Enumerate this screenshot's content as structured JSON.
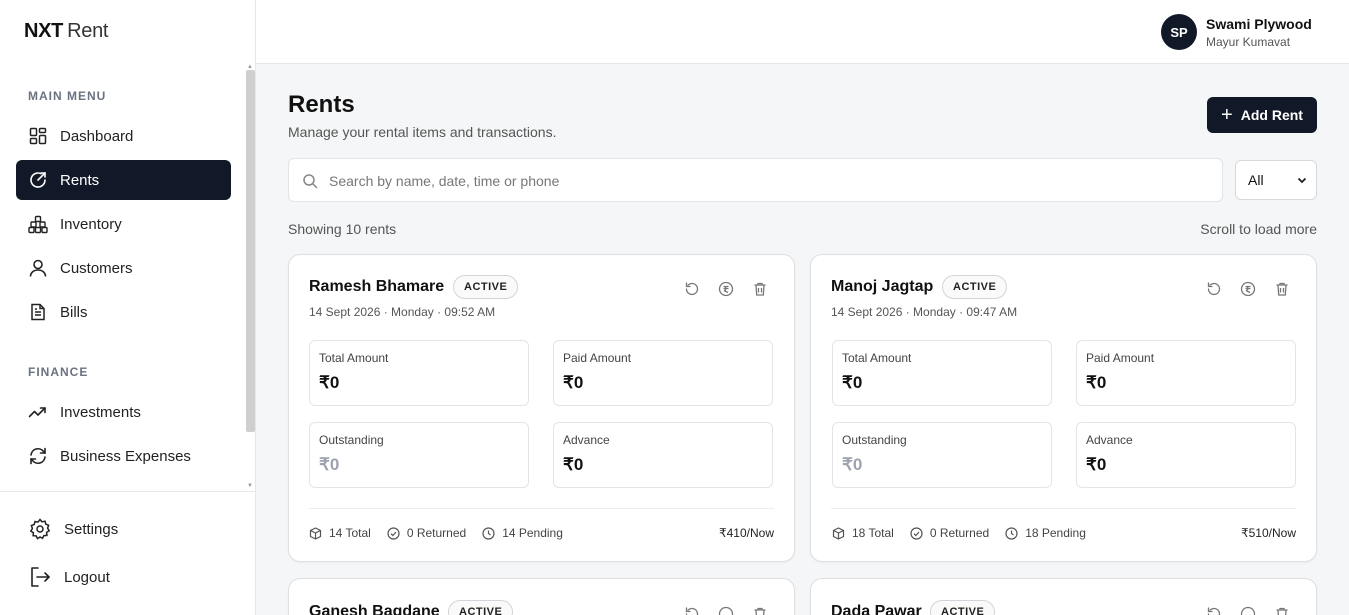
{
  "brand": {
    "bold": "NXT",
    "light": "Rent"
  },
  "sidebar": {
    "main_menu_title": "MAIN MENU",
    "items": [
      {
        "label": "Dashboard",
        "icon": "grid-icon"
      },
      {
        "label": "Rents",
        "icon": "rent-icon",
        "active": true
      },
      {
        "label": "Inventory",
        "icon": "boxes-icon"
      },
      {
        "label": "Customers",
        "icon": "user-icon"
      },
      {
        "label": "Bills",
        "icon": "file-icon"
      }
    ],
    "finance_title": "FINANCE",
    "finance_items": [
      {
        "label": "Investments",
        "icon": "trend-up-icon"
      },
      {
        "label": "Business Expenses",
        "icon": "refresh-icon"
      }
    ],
    "settings_label": "Settings",
    "logout_label": "Logout"
  },
  "header": {
    "avatar_initials": "SP",
    "user_name": "Swami Plywood",
    "user_sub": "Mayur Kumavat"
  },
  "main": {
    "title": "Rents",
    "subtitle": "Manage your rental items and transactions.",
    "add_button_label": "Add Rent",
    "search_placeholder": "Search by name, date, time or phone",
    "search_value": "",
    "filter_value": "All",
    "showing_text": "Showing 10 rents",
    "scroll_hint": "Scroll to load more"
  },
  "labels": {
    "total_amount": "Total Amount",
    "paid_amount": "Paid Amount",
    "outstanding": "Outstanding",
    "advance": "Advance"
  },
  "cards": [
    {
      "name": "Ramesh Bhamare",
      "status": "ACTIVE",
      "datetime": "14 Sept 2026 · Monday · 09:52 AM",
      "total_amount": "₹0",
      "paid_amount": "₹0",
      "outstanding": "₹0",
      "advance": "₹0",
      "total_items": "14 Total",
      "returned": "0 Returned",
      "pending": "14 Pending",
      "rate": "₹410/Now"
    },
    {
      "name": "Manoj Jagtap",
      "status": "ACTIVE",
      "datetime": "14 Sept 2026 · Monday · 09:47 AM",
      "total_amount": "₹0",
      "paid_amount": "₹0",
      "outstanding": "₹0",
      "advance": "₹0",
      "total_items": "18 Total",
      "returned": "0 Returned",
      "pending": "18 Pending",
      "rate": "₹510/Now"
    },
    {
      "name": "Ganesh Bagdane",
      "status": "ACTIVE"
    },
    {
      "name": "Dada Pawar",
      "status": "ACTIVE"
    }
  ],
  "colors": {
    "primary": "#111827",
    "muted_value": "#9ca3af",
    "background": "#f5f6f7"
  }
}
